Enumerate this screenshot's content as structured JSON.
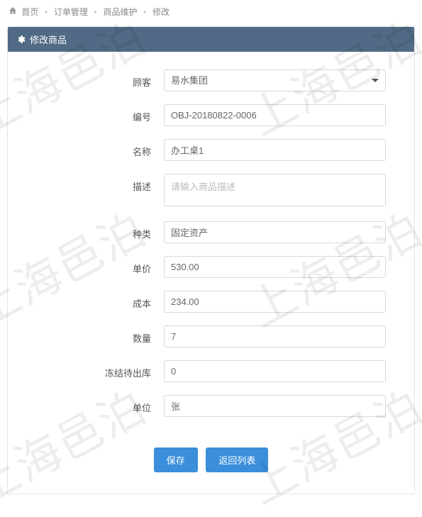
{
  "breadcrumb": {
    "home": "首页",
    "items": [
      "订单管理",
      "商品维护",
      "修改"
    ]
  },
  "panel": {
    "title": "修改商品"
  },
  "form": {
    "customer": {
      "label": "顾客",
      "value": "易水集团"
    },
    "code": {
      "label": "编号",
      "value": "OBJ-20180822-0006"
    },
    "name": {
      "label": "名称",
      "value": "办工桌1"
    },
    "desc": {
      "label": "描述",
      "value": "",
      "placeholder": "请输入商品描述"
    },
    "category": {
      "label": "种类",
      "value": "固定资产"
    },
    "price": {
      "label": "单价",
      "value": "530.00"
    },
    "cost": {
      "label": "成本",
      "value": "234.00"
    },
    "qty": {
      "label": "数量",
      "value": "7"
    },
    "frozen": {
      "label": "冻结待出库",
      "value": "0"
    },
    "unit": {
      "label": "单位",
      "value": "张"
    }
  },
  "buttons": {
    "save": "保存",
    "back": "返回列表"
  },
  "watermark": "上海邑泊"
}
